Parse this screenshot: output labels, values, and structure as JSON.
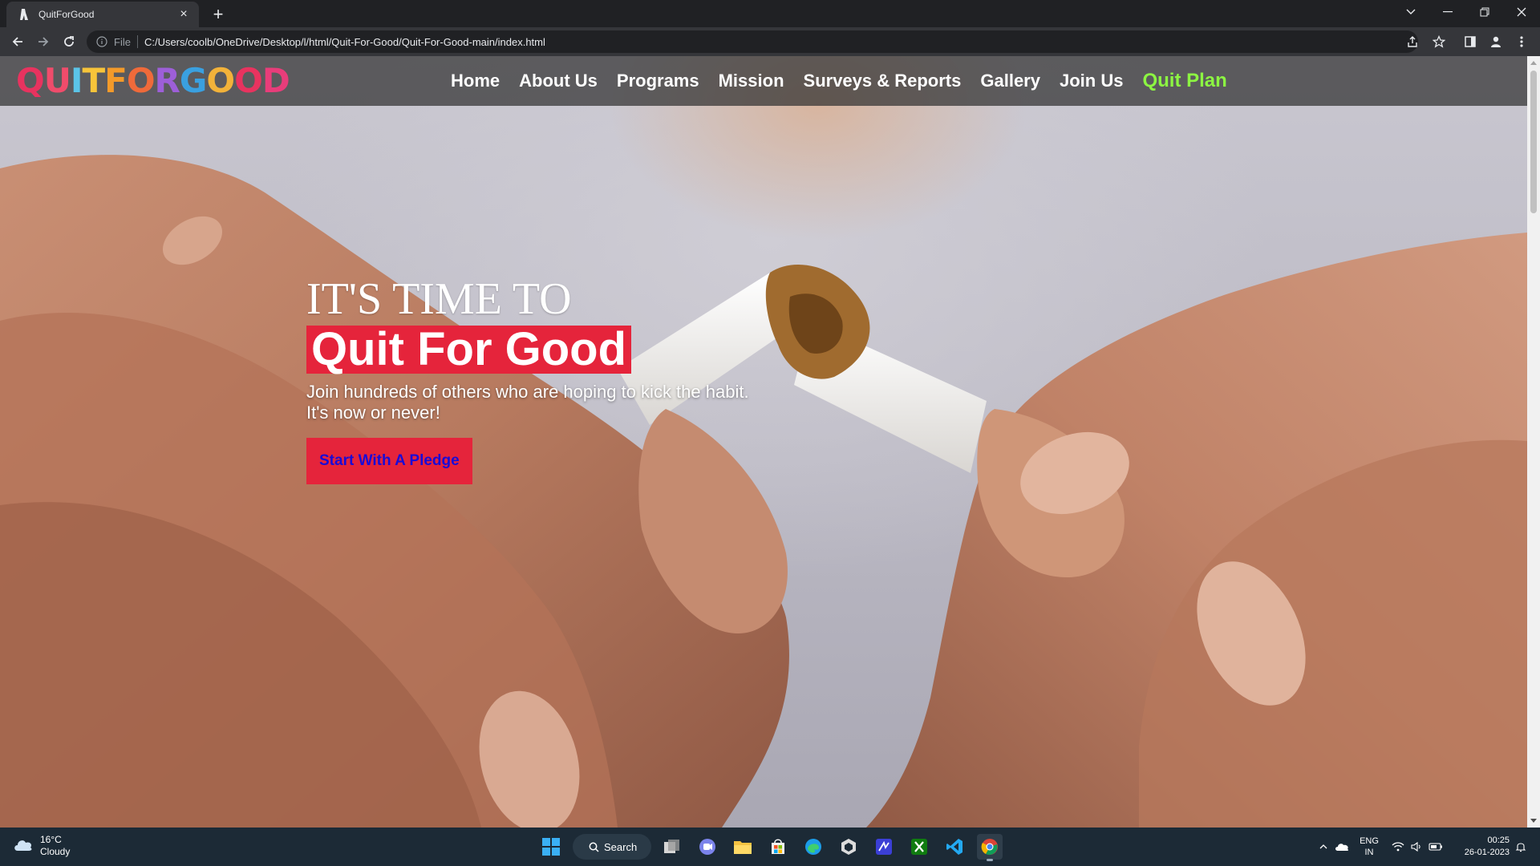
{
  "browser": {
    "tab_title": "QuitForGood",
    "new_tab": "+",
    "tab_close": "×",
    "url_label": "File",
    "url": "C:/Users/coolb/OneDrive/Desktop/l/html/Quit-For-Good/Quit-For-Good-main/index.html"
  },
  "site": {
    "logo_letters": [
      "Q",
      "U",
      "I",
      "T",
      "F",
      "O",
      "R",
      "G",
      "O",
      "O",
      "D"
    ],
    "logo_colors": [
      "#e8335f",
      "#f04c6b",
      "#5bc4e8",
      "#f7c43a",
      "#f39a2a",
      "#ef6a3a",
      "#9d5fd8",
      "#3aa0e0",
      "#f2b23a",
      "#e8335f",
      "#e83d7a"
    ],
    "nav": [
      {
        "label": "Home"
      },
      {
        "label": "About Us"
      },
      {
        "label": "Programs"
      },
      {
        "label": "Mission"
      },
      {
        "label": "Surveys & Reports"
      },
      {
        "label": "Gallery"
      },
      {
        "label": "Join Us"
      },
      {
        "label": "Quit Plan"
      }
    ],
    "nav_highlight_color": "#8cf542",
    "accent_color": "#e5243b",
    "hero": {
      "kicker": "IT'S TIME TO",
      "headline": "Quit For Good",
      "sub_line1": "Join hundreds of others who are hoping to kick the habit.",
      "sub_line2": "It's now or never!",
      "cta": "Start With A Pledge"
    }
  },
  "taskbar": {
    "weather_temp": "16°C",
    "weather_desc": "Cloudy",
    "search_label": "Search",
    "lang_line1": "ENG",
    "lang_line2": "IN",
    "time": "00:25",
    "date": "26-01-2023"
  }
}
